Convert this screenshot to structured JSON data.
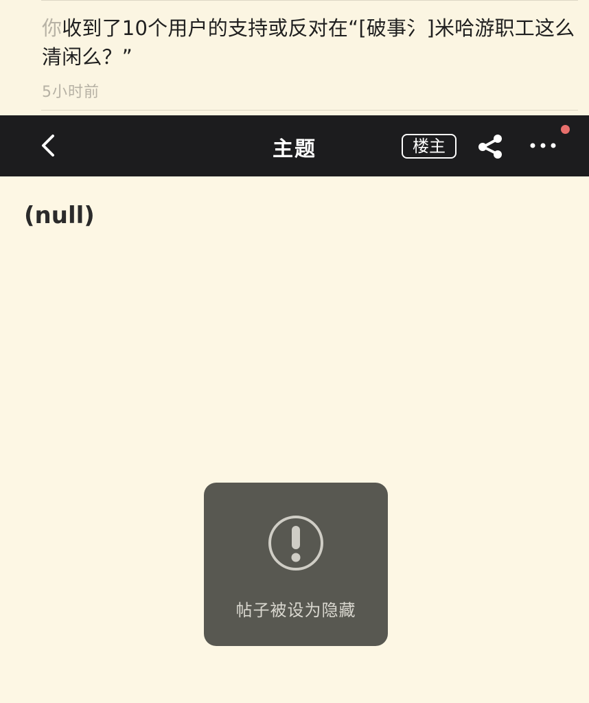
{
  "notification": {
    "actor": "你",
    "message": "收到了10个用户的支持或反对在“[破事氵]米哈游职工这么清闲么？”",
    "time": "5小时前"
  },
  "navbar": {
    "back_icon": "chevron-left-icon",
    "title": "主题",
    "op_badge": "楼主",
    "share_icon": "share-icon",
    "more_icon": "more-dots-icon",
    "has_unread_dot": true,
    "unread_dot_color": "#e86f6c"
  },
  "post": {
    "title": "(null)"
  },
  "toast": {
    "icon": "exclamation-circle-icon",
    "message": "帖子被设为隐藏"
  }
}
